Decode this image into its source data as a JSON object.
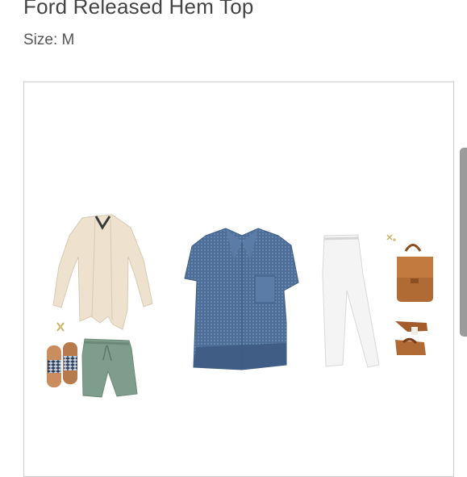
{
  "product": {
    "title": "Ford Released Hem Top",
    "size_label": "Size: M"
  },
  "outfit": {
    "items": [
      {
        "icon": "cardigan-icon",
        "color": "#eee2cf"
      },
      {
        "icon": "earrings-icon",
        "color": "#c9b06a"
      },
      {
        "icon": "sandals-icon",
        "color": "#2e3f5c"
      },
      {
        "icon": "shorts-icon",
        "color": "#7f9d8c"
      },
      {
        "icon": "shirt-icon",
        "color": "#4d6f99"
      },
      {
        "icon": "jeans-icon",
        "color": "#f4f4f4"
      },
      {
        "icon": "stud-earrings-icon",
        "color": "#c9b06a"
      },
      {
        "icon": "backpack-icon",
        "color": "#b06a33"
      },
      {
        "icon": "wedge-sandals-icon",
        "color": "#a45c2c"
      }
    ]
  }
}
